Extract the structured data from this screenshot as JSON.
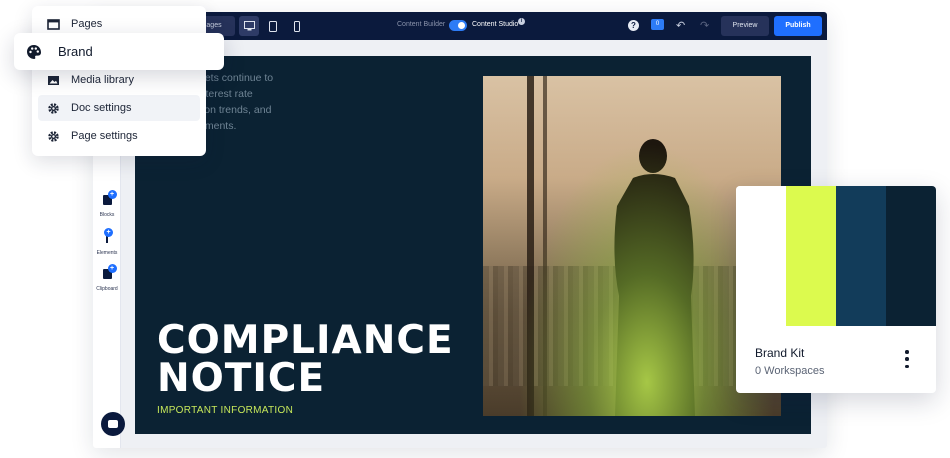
{
  "menu": {
    "items": [
      {
        "label": "Pages",
        "icon": "window-icon"
      },
      {
        "label": "Media library",
        "icon": "image-icon"
      },
      {
        "label": "Doc settings",
        "icon": "gear-icon"
      },
      {
        "label": "Page settings",
        "icon": "gear-icon"
      }
    ],
    "brand": {
      "label": "Brand",
      "icon": "palette-icon"
    }
  },
  "topbar": {
    "pages_label": "ages",
    "mode_left": "Content Builder",
    "mode_right": "Content Studio",
    "info_glyph": "i",
    "help_glyph": "?",
    "badge_count": "0",
    "undo_glyph": "↶",
    "redo_glyph": "↷",
    "preview_label": "Preview",
    "publish_label": "Publish"
  },
  "rail": {
    "tools": [
      {
        "label": "Blocks",
        "plus": "+"
      },
      {
        "label": "Elements",
        "plus": "+"
      },
      {
        "label": "Clipboard",
        "plus": "+"
      }
    ]
  },
  "canvas": {
    "intro_text": "ncial markets continue to\nhanging interest rate\nons, inflation trends, and\nal developments.",
    "title_line1": "COMPLIANCE",
    "title_line2": "NOTICE",
    "subtitle": "IMPORTANT INFORMATION"
  },
  "brand_kit": {
    "title": "Brand Kit",
    "subtitle": "0 Workspaces",
    "swatches": [
      "#ffffff",
      "#dcfa4e",
      "#123c5a",
      "#0b2233"
    ]
  },
  "colors": {
    "topbar": "#0b1a3d",
    "accent": "#1f6fff",
    "canvas_bg": "#0b2233",
    "highlight": "#c7e85a"
  }
}
